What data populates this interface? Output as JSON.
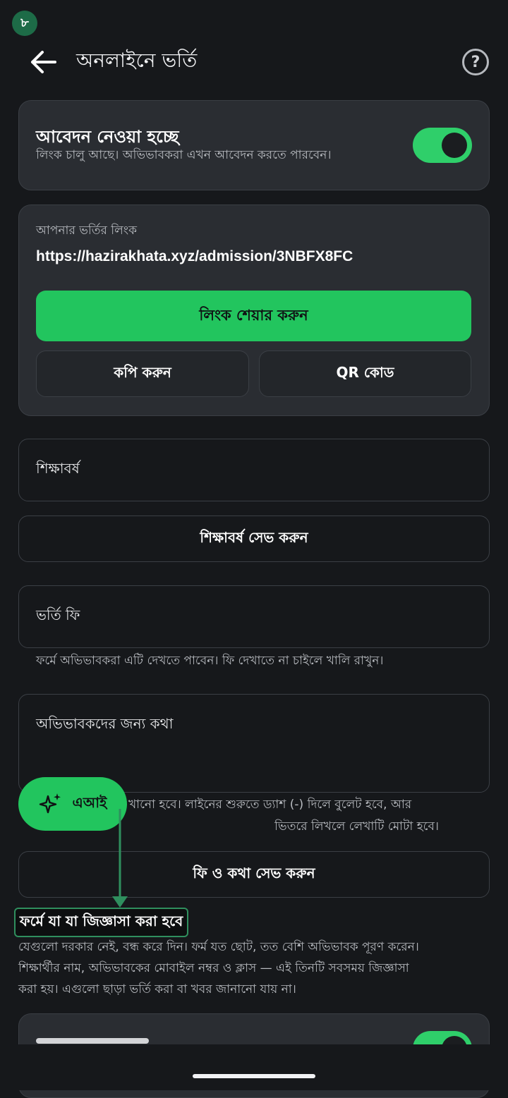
{
  "status": {
    "badge": "৮"
  },
  "header": {
    "title": "অনলাইনে ভর্তি",
    "back_icon": "arrow-left-icon",
    "help_label": "?"
  },
  "accepting": {
    "title": "আবেদন নেওয়া হচ্ছে",
    "subtitle": "লিংক চালু আছে। অভিভাবকরা এখন আবেদন করতে পারবেন।",
    "enabled": true
  },
  "link_card": {
    "label": "আপনার ভর্তির লিংক",
    "url": "https://hazirakhata.xyz/admission/3NBFX8FC",
    "share_label": "লিংক শেয়ার করুন",
    "copy_label": "কপি করুন",
    "qr_label": "QR কোড"
  },
  "academic_year": {
    "label": "শিক্ষাবর্ষ",
    "save_label": "শিক্ষাবর্ষ সেভ করুন"
  },
  "fee": {
    "label": "ভর্তি ফি",
    "helper": "ফর্মে অভিভাবকরা এটি দেখতে পাবেন। ফি দেখাতে না চাইলে খালি রাখুন।"
  },
  "note": {
    "label": "অভিভাবকদের জন্য কথা",
    "helper_line1": "খানো হবে। লাইনের শুরুতে ড্যাশ (-) দিলে বুলেট হবে, আর",
    "helper_line2": "ভিতরে লিখলে লেখাটি মোটা হবে।",
    "save_label": "ফি ও কথা সেভ করুন"
  },
  "ai_fab": {
    "label": "এআই",
    "icon": "sparkle-icon"
  },
  "form_section": {
    "title": "ফর্মে যা যা জিজ্ঞাসা করা হবে",
    "desc_line1": "যেগুলো দরকার নেই, বন্ধ করে দিন। ফর্ম যত ছোট, তত বেশি অভিভাবক পূরণ করেন।",
    "desc_line2": "শিক্ষার্থীর নাম, অভিভাবকের মোবাইল নম্বর ও ক্লাস — এই তিনটি সবসময় জিজ্ঞাসা",
    "desc_line3": "করা হয়। এগুলো ছাড়া ভর্তি করা বা খবর জানানো যায় না।"
  },
  "colors": {
    "accent": "#22c55e",
    "background": "#16181b",
    "card": "#2a2d32"
  }
}
